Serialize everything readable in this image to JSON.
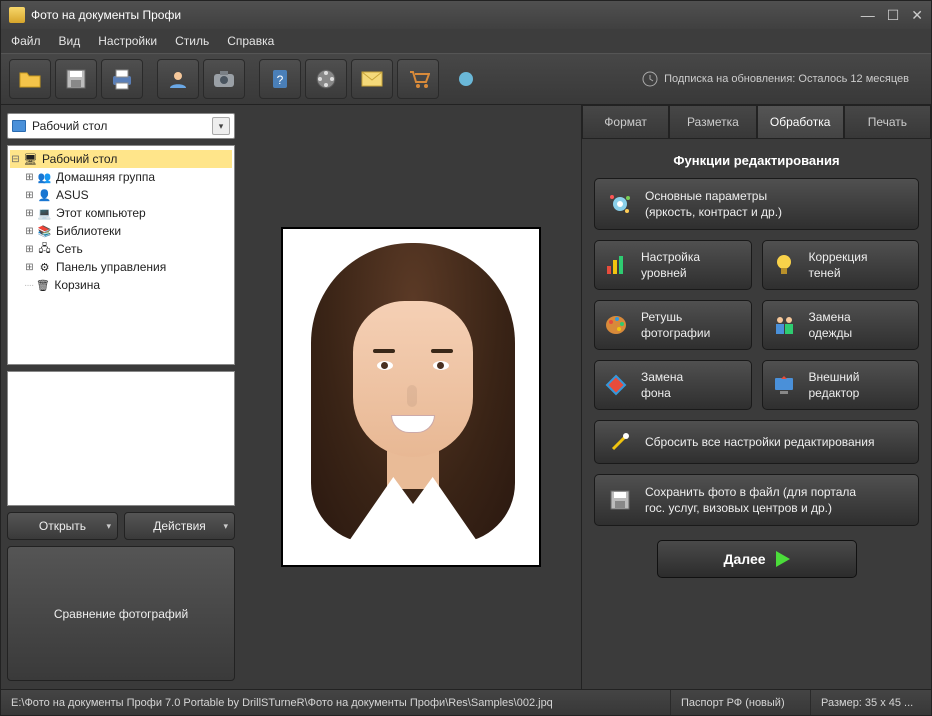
{
  "titlebar": {
    "title": "Фото на документы Профи"
  },
  "menu": {
    "file": "Файл",
    "view": "Вид",
    "settings": "Настройки",
    "style": "Стиль",
    "help": "Справка"
  },
  "toolbar": {
    "icons": [
      "folder-open-icon",
      "save-icon",
      "print-icon",
      "portrait-icon",
      "camera-icon",
      "help-book-icon",
      "film-reel-icon",
      "mail-icon",
      "cart-icon"
    ],
    "subscription_label": "Подписка на обновления: Осталось 12 месяцев"
  },
  "left": {
    "combo_label": "Рабочий стол",
    "tree": {
      "root": "Рабочий стол",
      "children": [
        {
          "label": "Домашняя группа",
          "icon": "homegroup-icon"
        },
        {
          "label": "ASUS",
          "icon": "user-icon"
        },
        {
          "label": "Этот компьютер",
          "icon": "computer-icon"
        },
        {
          "label": "Библиотеки",
          "icon": "libraries-icon"
        },
        {
          "label": "Сеть",
          "icon": "network-icon"
        },
        {
          "label": "Панель управления",
          "icon": "control-panel-icon"
        },
        {
          "label": "Корзина",
          "icon": "recycle-bin-icon"
        }
      ]
    },
    "open_btn": "Открыть",
    "actions_btn": "Действия",
    "compare_btn": "Сравнение фотографий"
  },
  "tabs": {
    "format": "Формат",
    "markup": "Разметка",
    "processing": "Обработка",
    "print": "Печать",
    "active": "processing"
  },
  "processing": {
    "title": "Функции редактирования",
    "main_params": "Основные параметры\n(яркость, контраст и др.)",
    "levels": "Настройка\nуровней",
    "shadows": "Коррекция\nтеней",
    "retouch": "Ретушь\nфотографии",
    "clothes": "Замена\nодежды",
    "background": "Замена\nфона",
    "external": "Внешний\nредактор",
    "reset": "Сбросить все настройки редактирования",
    "save": "Сохранить фото в файл (для портала\nгос. услуг, визовых центров и др.)",
    "next": "Далее"
  },
  "status": {
    "path": "E:\\Фото на документы Профи 7.0 Portable by DrillSTurneR\\Фото на документы Профи\\Res\\Samples\\002.jpq",
    "doc_type": "Паспорт РФ (новый)",
    "size": "Размер: 35 x 45 ..."
  },
  "colors": {
    "accent_green": "#4bdc3a"
  }
}
